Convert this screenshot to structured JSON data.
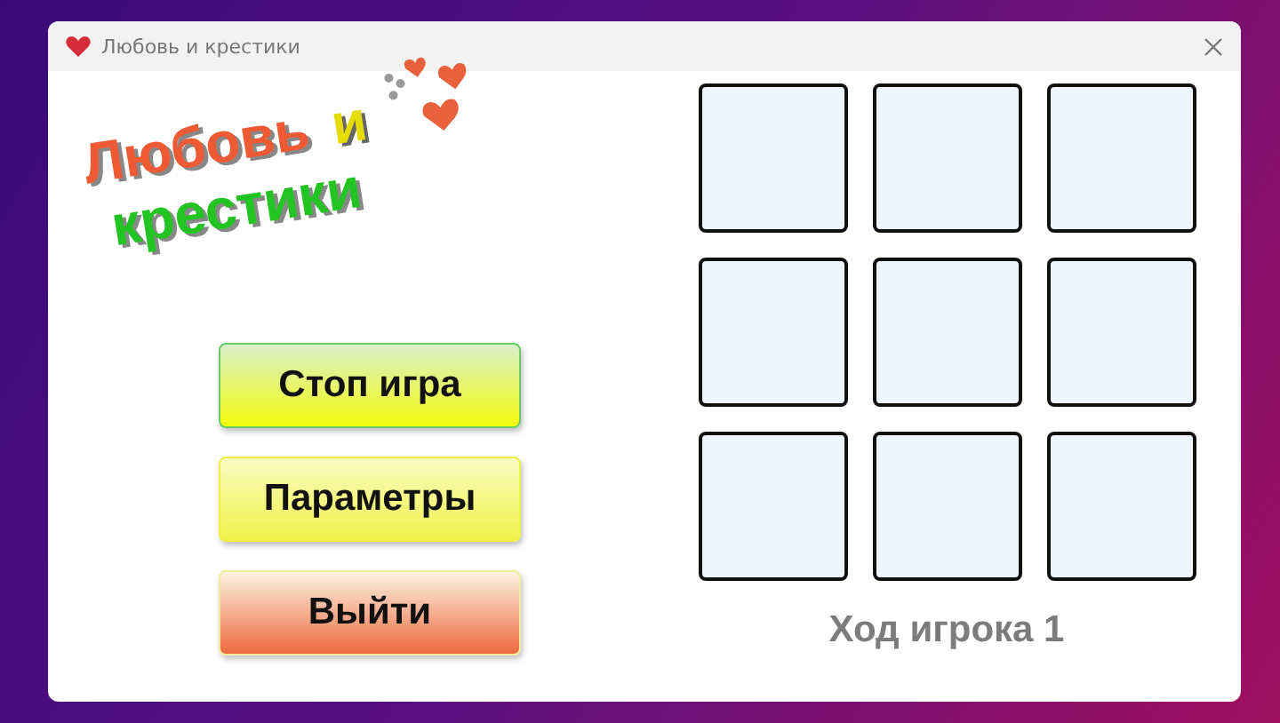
{
  "window": {
    "title": "Любовь и крестики"
  },
  "logo": {
    "line1": "Любовь",
    "conjunction": "и",
    "line2": "крестики"
  },
  "buttons": [
    {
      "label": "Стоп игра",
      "kind": "green"
    },
    {
      "label": "Параметры",
      "kind": "yellow"
    },
    {
      "label": "Выйти",
      "kind": "red"
    }
  ],
  "board": {
    "cells": [
      {
        "marked": false
      },
      {
        "marked": false
      },
      {
        "marked": false
      },
      {
        "marked": false
      },
      {
        "marked": false
      },
      {
        "marked": false
      },
      {
        "marked": false
      },
      {
        "marked": false
      },
      {
        "marked": false
      }
    ]
  },
  "status": "Ход игрока 1"
}
